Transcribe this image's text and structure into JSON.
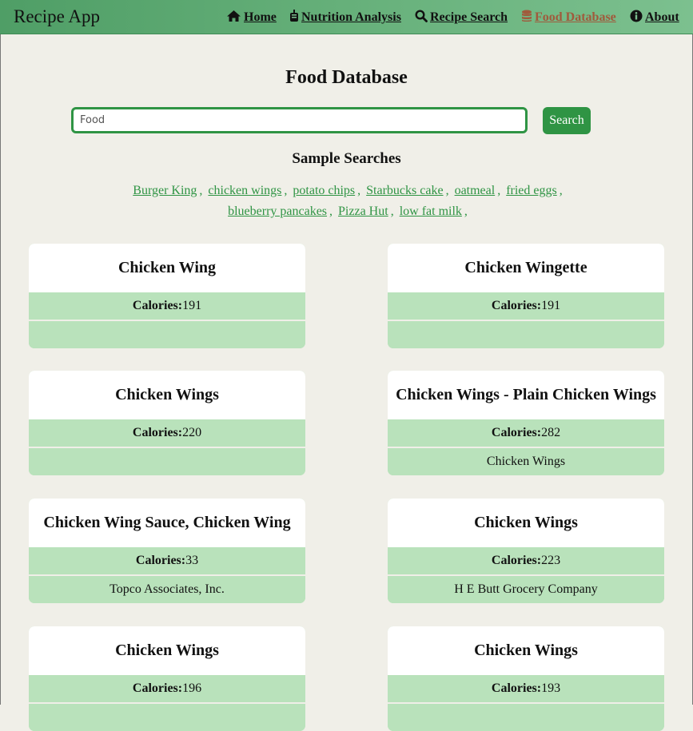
{
  "app": {
    "brand": "Recipe App"
  },
  "nav": [
    {
      "label": "Home",
      "icon": "home-icon"
    },
    {
      "label": "Nutrition Analysis",
      "icon": "apple-icon"
    },
    {
      "label": "Recipe Search",
      "icon": "search-icon"
    },
    {
      "label": "Food Database",
      "icon": "database-icon",
      "active": true
    },
    {
      "label": "About",
      "icon": "info-icon"
    }
  ],
  "page": {
    "title": "Food Database"
  },
  "search": {
    "placeholder": "Food",
    "button_label": "Search"
  },
  "samples": {
    "title": "Sample Searches",
    "items": [
      "Burger King",
      "chicken wings",
      "potato chips",
      "Starbucks cake",
      "oatmeal",
      "fried eggs",
      "blueberry pancakes",
      "Pizza Hut",
      "low fat milk"
    ]
  },
  "calories_label": "Calories:",
  "cards": [
    {
      "title": "Chicken Wing",
      "calories": "191",
      "brand": ""
    },
    {
      "title": "Chicken Wingette",
      "calories": "191",
      "brand": ""
    },
    {
      "title": "Chicken Wings",
      "calories": "220",
      "brand": ""
    },
    {
      "title": "Chicken Wings - Plain Chicken Wings",
      "calories": "282",
      "brand": "Chicken Wings"
    },
    {
      "title": "Chicken Wing Sauce, Chicken Wing",
      "calories": "33",
      "brand": "Topco Associates, Inc."
    },
    {
      "title": "Chicken Wings",
      "calories": "223",
      "brand": "H E Butt Grocery Company"
    },
    {
      "title": "Chicken Wings",
      "calories": "196",
      "brand": ""
    },
    {
      "title": "Chicken Wings",
      "calories": "193",
      "brand": ""
    }
  ],
  "colors": {
    "accent": "#2f9444",
    "card_row": "#b9e2bb",
    "active_nav": "#a05a3c",
    "background": "#f0efe8"
  }
}
